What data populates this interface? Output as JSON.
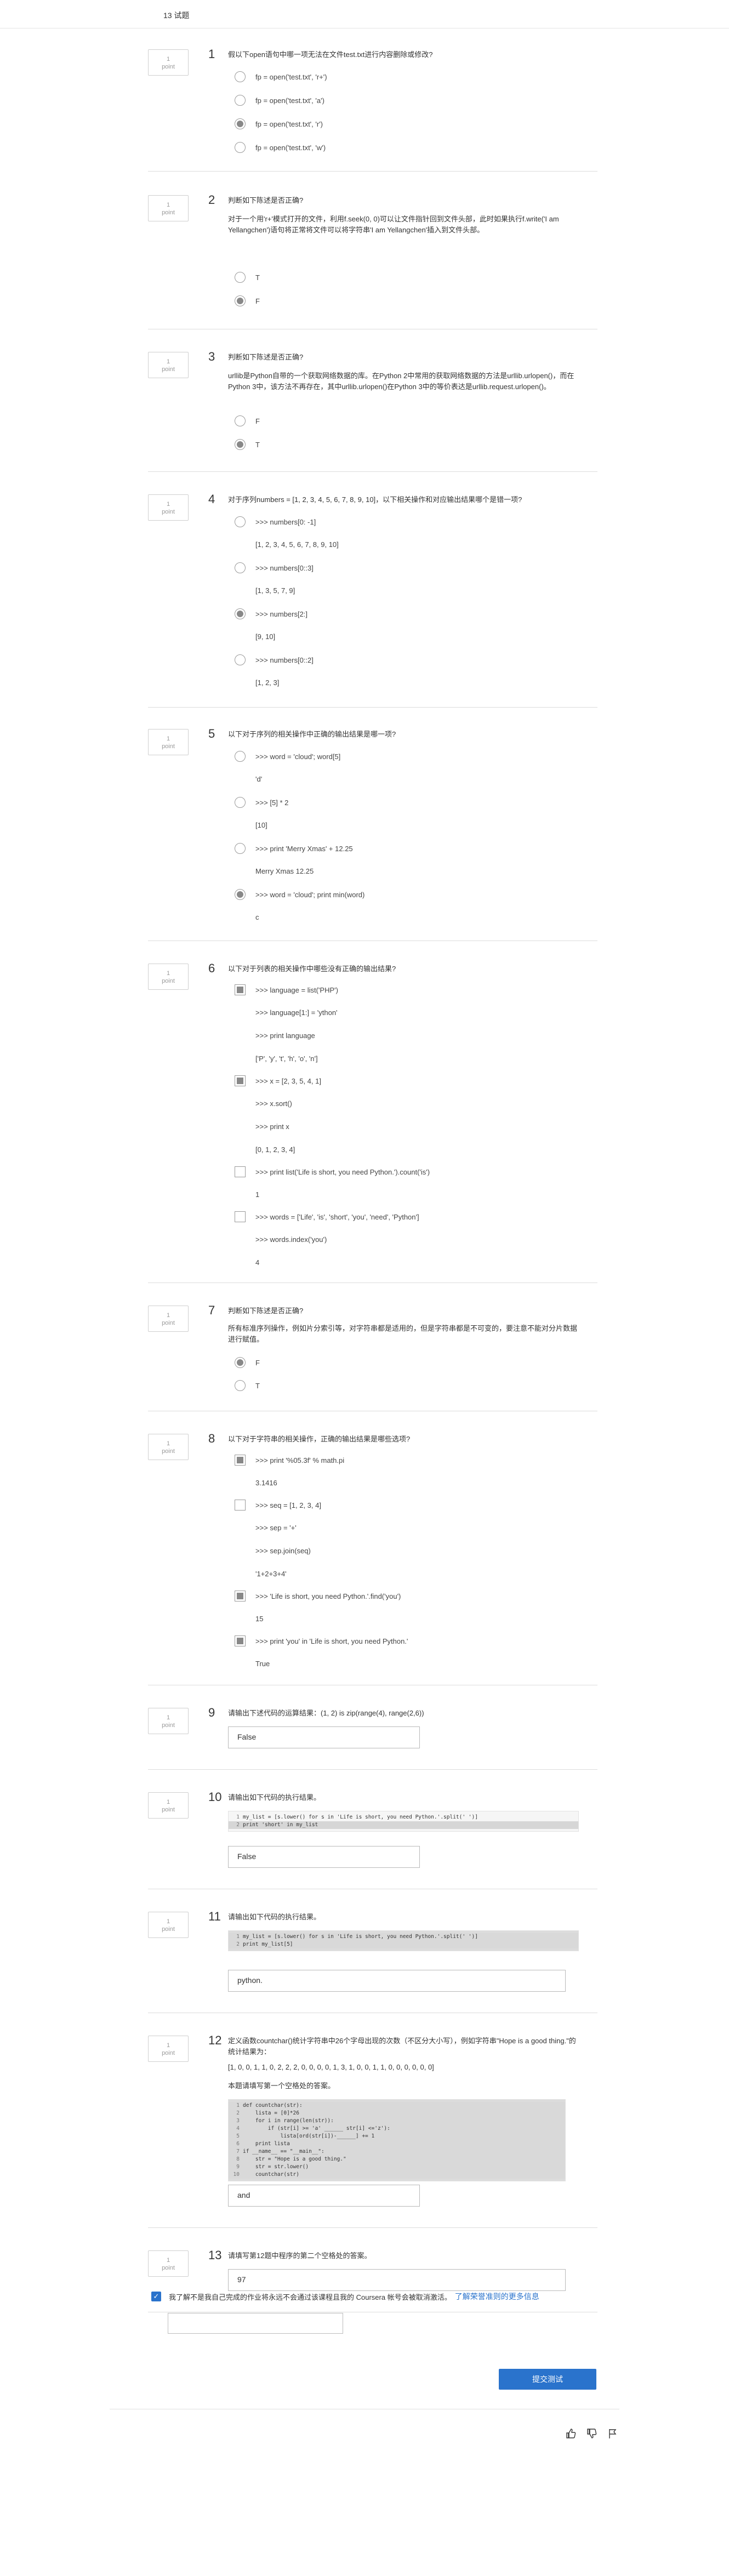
{
  "header": {
    "question_count": "13 试题"
  },
  "point_label": {
    "num": "1",
    "unit": "point"
  },
  "questions": [
    {
      "num": "1",
      "text": "假以下open语句中哪一项无法在文件test.txt进行内容删除或修改?",
      "options": [
        "fp = open('test.txt', 'r+')",
        "fp = open('test.txt', 'a')",
        "fp = open('test.txt', 'r')",
        "fp = open('test.txt', 'w')"
      ]
    },
    {
      "num": "2",
      "text": "判断如下陈述是否正确?",
      "body": "对于一个用'r+'模式打开的文件，利用f.seek(0, 0)可以让文件指针回到文件头部，此时如果执行f.write('I am Yellangchen')语句将正常将文件可以将字符串'I am Yellangchen'插入到文件头部。",
      "options": [
        "T",
        "F"
      ]
    },
    {
      "num": "3",
      "text": "判断如下陈述是否正确?",
      "body": "urllib是Python自带的一个获取网络数据的库。在Python 2中常用的获取网络数据的方法是urllib.urlopen()，而在Python 3中，该方法不再存在，其中urllib.urlopen()在Python 3中的等价表达是urllib.request.urlopen()。",
      "options": [
        "F",
        "T"
      ]
    },
    {
      "num": "4",
      "text": "对于序列numbers = [1, 2, 3, 4, 5, 6, 7, 8, 9, 10]，以下相关操作和对应输出结果哪个是错一项?",
      "options": [
        ">>> numbers[0: -1]",
        ">>> numbers[0::3]",
        ">>> numbers[2:]",
        ">>> numbers[0::2]"
      ],
      "results": [
        "[1, 2, 3, 4, 5, 6, 7, 8, 9, 10]",
        "[1, 3, 5, 7, 9]",
        "[9, 10]",
        "[1, 2, 3]"
      ]
    },
    {
      "num": "5",
      "text": "以下对于序列的相关操作中正确的输出结果是哪一项?",
      "options": [
        ">>> word = 'cloud'; word[5]",
        ">>> [5] * 2",
        ">>> print 'Merry Xmas' + 12.25",
        ">>> word = 'cloud'; print min(word)"
      ],
      "results": [
        "'d'",
        "[10]",
        "Merry Xmas 12.25",
        "c"
      ]
    },
    {
      "num": "6",
      "text": "以下对于列表的相关操作中哪些没有正确的输出结果?",
      "options": [
        ">>> language = list('PHP')",
        ">>> x = [2, 3, 5, 4, 1]",
        ">>> print list('Life is short, you need Python.').count('is')",
        ">>> words = ['Life', 'is', 'short', 'you', 'need', 'Python']"
      ],
      "lines": [
        ">>> language[1:] = 'ython'",
        ">>> print language",
        "['P', 'y', 't', 'h', 'o', 'n']",
        ">>> x.sort()",
        ">>> print x",
        "[0, 1, 2, 3, 4]",
        "1",
        ">>> words.index('you')",
        "4"
      ]
    },
    {
      "num": "7",
      "text": "判断如下陈述是否正确?",
      "body": "所有标准序列操作，例如片分索引等，对字符串都是适用的，但是字符串都是不可变的，要注意不能对分片数据进行赋值。",
      "options": [
        "F",
        "T"
      ]
    },
    {
      "num": "8",
      "text": "以下对于字符串的相关操作，正确的输出结果是哪些选项?",
      "options": [
        ">>> print '%05.3f' % math.pi",
        ">>> seq = [1, 2, 3, 4]",
        ">>> 'Life is short, you need Python.'.find('you')",
        ">>> print 'you' in 'Life is short, you need Python.'"
      ],
      "lines": [
        "3.1416",
        ">>> sep = '+'",
        ">>> sep.join(seq)",
        "'1+2+3+4'",
        "15",
        "True"
      ]
    },
    {
      "num": "9",
      "text": "请输出下述代码的运算结果：(1, 2) is zip(range(4), range(2,6))",
      "answer": "False"
    },
    {
      "num": "10",
      "text": "请输出如下代码的执行结果。",
      "code": [
        "my_list = [s.lower() for s in 'Life is short, you need Python.'.split(' ')]",
        "print 'short' in my_list"
      ],
      "answer": "False"
    },
    {
      "num": "11",
      "text": "请输出如下代码的执行结果。",
      "code": [
        "my_list = [s.lower() for s in 'Life is short, you need Python.'.split(' ')]",
        "print my_list[5]"
      ],
      "answer": "python."
    },
    {
      "num": "12",
      "text": "定义函数countchar()统计字符串中26个字母出现的次数（不区分大小写），例如字符串\"Hope is a good thing.\"的统计结果为：",
      "body": "[1, 0, 0, 1, 1, 0, 2, 2, 2, 0, 0, 0, 0, 1, 3, 1, 0, 0, 1, 1, 0, 0, 0, 0, 0, 0]",
      "body2": "本题请填写第一个空格处的答案。",
      "code": [
        "def countchar(str):",
        "    lista = [0]*26",
        "    for i in range(len(str)):",
        "        if (str[i] >= 'a' ______ str[i] <='z'):",
        "            lista[ord(str[i])-______] += 1",
        "    print lista",
        "if __name__ == \"__main__\":",
        "    str = \"Hope is a good thing.\"",
        "    str = str.lower()",
        "    countchar(str)"
      ],
      "answer": "and"
    },
    {
      "num": "13",
      "text": "请填写第12题中程序的第二个空格处的答案。",
      "answer": "97"
    }
  ],
  "footer": {
    "honor_text": "我了解不是我自己完成的作业将永远不会通过该课程且我的 Coursera 帐号会被取消激活。",
    "honor_link": "了解荣誉准则的更多信息",
    "submit_label": "提交测试",
    "like_icon": "thumbs-up-icon",
    "dislike_icon": "thumbs-down-icon",
    "flag_icon": "flag-icon"
  }
}
